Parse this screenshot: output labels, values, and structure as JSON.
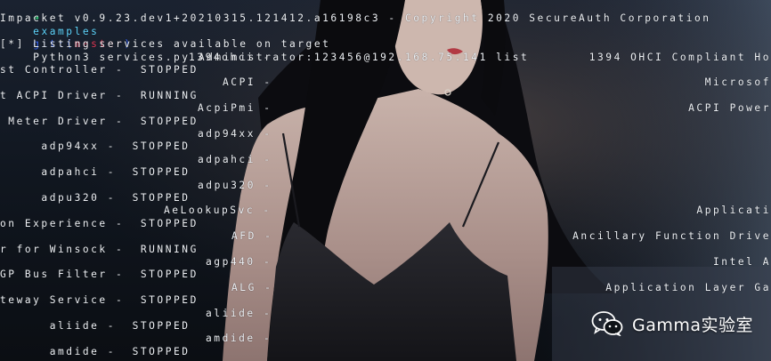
{
  "prompt": {
    "arrow": "➜",
    "dir": "examples",
    "git_label": "git:(",
    "branch": "master",
    "git_close": ")",
    "command": "Python3 services.py Administrator:123456@192.168.75.141 list"
  },
  "output": {
    "banner": "Impacket v0.9.23.dev1+20210315.121412.a16198c3 - Copyright 2020 SecureAuth Corporation",
    "info": "[*] Listing services available on target",
    "lines": [
      {
        "left": "1394ohci -",
        "right": "1394 OHCI Compliant Ho"
      },
      {
        "left": "st Controller -  STOPPED",
        "right": ""
      },
      {
        "left": "ACPI -",
        "right": "Microsof"
      },
      {
        "left": "t ACPI Driver -  RUNNING",
        "right": ""
      },
      {
        "left": "AcpiPmi -",
        "right": "ACPI Power"
      },
      {
        "left": " Meter Driver -  STOPPED",
        "right": ""
      },
      {
        "left": "adp94xx -",
        "right": ""
      },
      {
        "left": "     adp94xx -  STOPPED",
        "right": ""
      },
      {
        "left": "adpahci -",
        "right": ""
      },
      {
        "left": "     adpahci -  STOPPED",
        "right": ""
      },
      {
        "left": "adpu320 -",
        "right": ""
      },
      {
        "left": "     adpu320 -  STOPPED",
        "right": ""
      },
      {
        "left": "AeLookupSvc -",
        "right": "Applicati"
      },
      {
        "left": "on Experience -  STOPPED",
        "right": ""
      },
      {
        "left": "AFD -",
        "right": "Ancillary Function Drive"
      },
      {
        "left": "r for Winsock -  RUNNING",
        "right": ""
      },
      {
        "left": "agp440 -",
        "right": "Intel A"
      },
      {
        "left": "GP Bus Filter -  STOPPED",
        "right": ""
      },
      {
        "left": "ALG -",
        "right": "Application Layer Ga"
      },
      {
        "left": "teway Service -  STOPPED",
        "right": ""
      },
      {
        "left": "aliide -",
        "right": ""
      },
      {
        "left": "      aliide -  STOPPED",
        "right": ""
      },
      {
        "left": "amdide -",
        "right": ""
      },
      {
        "left": "      amdide -  STOPPED",
        "right": ""
      }
    ]
  },
  "watermark": {
    "icon": "wechat-icon",
    "text": "Gamma实验室"
  }
}
